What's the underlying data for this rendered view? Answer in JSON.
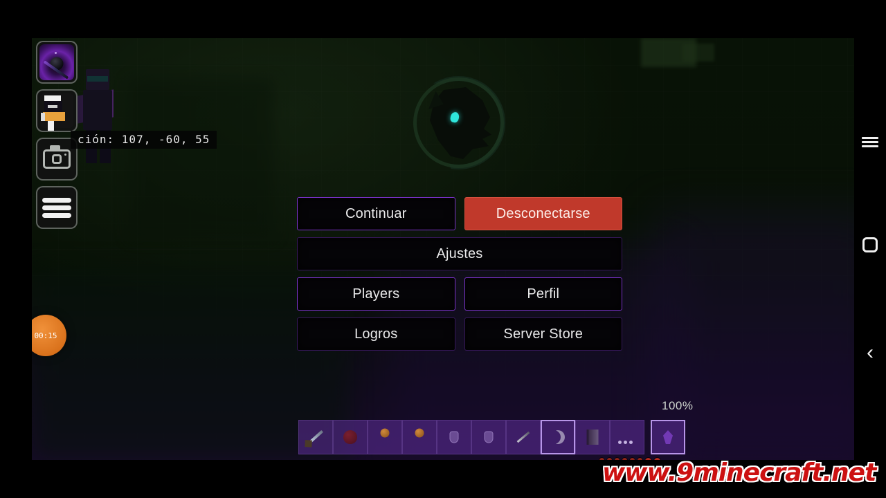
{
  "hud": {
    "coordinates_label": "ción: 107, -60, 55",
    "timer": "00:15",
    "buttons": [
      {
        "name": "portal-icon",
        "label": ""
      },
      {
        "name": "skin-avatar-icon",
        "label": ""
      },
      {
        "name": "camera-icon",
        "label": ""
      },
      {
        "name": "list-menu-icon",
        "label": ""
      }
    ]
  },
  "logo": {
    "alt": "wolf-head-emblem"
  },
  "menu": {
    "buttons": [
      {
        "label": "Continuar",
        "style": "normal"
      },
      {
        "label": "Desconectarse",
        "style": "danger"
      },
      {
        "label": "Ajustes",
        "style": "faint"
      },
      {
        "label": "Players",
        "style": "normal"
      },
      {
        "label": "Perfil",
        "style": "normal"
      },
      {
        "label": "Logros",
        "style": "faint"
      },
      {
        "label": "Server Store",
        "style": "faint"
      }
    ]
  },
  "hotbar": {
    "durability_percent": "100%",
    "slots": [
      {
        "item": "sword"
      },
      {
        "item": "apple"
      },
      {
        "item": "ball"
      },
      {
        "item": "ball"
      },
      {
        "item": "potion"
      },
      {
        "item": "potion"
      },
      {
        "item": "stick"
      },
      {
        "item": "moon"
      },
      {
        "item": "book"
      },
      {
        "item": "dots"
      },
      {
        "item": "shard"
      }
    ]
  },
  "navbar": {
    "recents_label": "recents",
    "home_label": "home",
    "back_label": "‹"
  },
  "watermark": {
    "text": "www.9minecraft.net"
  },
  "colors": {
    "accent_purple": "#7a32c8",
    "danger_red": "#c0392b",
    "world_green": "#13240f",
    "eye_cyan": "#2fe6dc",
    "watermark_red": "#cc1111"
  }
}
